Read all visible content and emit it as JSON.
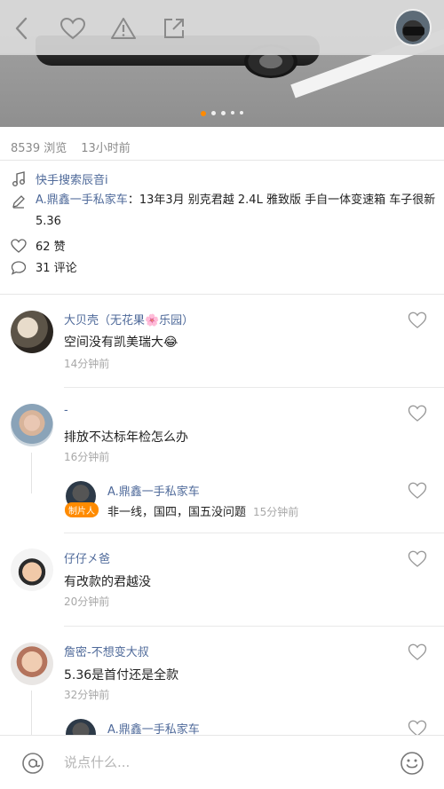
{
  "post": {
    "views": "8539 浏览",
    "posted_time": "13小时前",
    "music_link": "快手搜索辰音i",
    "author_label": "A.鼎鑫一手私家车",
    "colon": "：",
    "description": "13年3月 别克君越 2.4L 雅致版 手自一体变速箱 车子很新 5.36",
    "likes": "62 赞",
    "comments": "31 评论"
  },
  "comments": [
    {
      "name": "大贝壳（无花果🌸乐园）",
      "text": "空间没有凯美瑞大😂",
      "time": "14分钟前"
    },
    {
      "name": "-",
      "text": "排放不达标年检怎么办",
      "time": "16分钟前",
      "reply": {
        "name": "A.鼎鑫一手私家车",
        "badge": "制片人",
        "text": "非一线，国四，国五没问题",
        "time": "15分钟前"
      }
    },
    {
      "name": "仔仔㐅爸",
      "text": "有改款的君越没",
      "time": "20分钟前"
    },
    {
      "name": "詹密-不想变大叔",
      "text": "5.36是首付还是全款",
      "time": "32分钟前",
      "reply": {
        "name": "A.鼎鑫一手私家车"
      }
    }
  ],
  "input": {
    "placeholder": "说点什么..."
  },
  "colors": {
    "accent": "#ff8a00",
    "link": "#4f6a9a"
  }
}
